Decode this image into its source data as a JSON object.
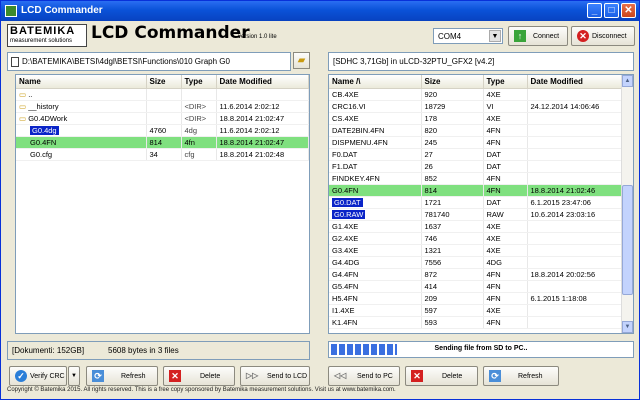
{
  "window": {
    "title": "LCD Commander"
  },
  "header": {
    "brand": "BATEMIKA",
    "brand_sub": "measurement solutions",
    "app_title": "LCD Commander",
    "version": "version 1.0 lite",
    "port": "COM4",
    "connect_label": "Connect",
    "disconnect_label": "Disconnect"
  },
  "left": {
    "path": "D:\\BATEMIKA\\BETSI\\4dgl\\BETSI\\Functions\\010 Graph G0",
    "columns": [
      "Name",
      "Size",
      "Type",
      "Date Modified"
    ],
    "rows": [
      {
        "name": "..",
        "size": "",
        "type": "",
        "date": ""
      },
      {
        "name": "__history",
        "size": "",
        "type": "<DIR>",
        "date": "11.6.2014 2:02:12"
      },
      {
        "name": "G0.4DWork",
        "size": "",
        "type": "<DIR>",
        "date": "18.8.2014 21:02:47"
      },
      {
        "name": "G0.4dg",
        "size": "4760",
        "type": "4dg",
        "date": "11.6.2014 2:02:12"
      },
      {
        "name": "G0.4FN",
        "size": "814",
        "type": "4fn",
        "date": "18.8.2014 21:02:47"
      },
      {
        "name": "G0.cfg",
        "size": "34",
        "type": "cfg",
        "date": "18.8.2014 21:02:48"
      }
    ],
    "status_label": "[Dokumenti: 152GB]",
    "status_info": "5608 bytes in 3 files"
  },
  "right": {
    "path": "[SDHC 3,71Gb] in uLCD-32PTU_GFX2 [v4.2]",
    "columns": [
      "Name  /\\",
      "Size",
      "Type",
      "Date Modified"
    ],
    "rows": [
      {
        "name": "CB.4XE",
        "size": "920",
        "type": "4XE",
        "date": ""
      },
      {
        "name": "CRC16.VI",
        "size": "18729",
        "type": "VI",
        "date": "24.12.2014 14:06:46"
      },
      {
        "name": "CS.4XE",
        "size": "178",
        "type": "4XE",
        "date": ""
      },
      {
        "name": "DATE2BIN.4FN",
        "size": "820",
        "type": "4FN",
        "date": ""
      },
      {
        "name": "DISPMENU.4FN",
        "size": "245",
        "type": "4FN",
        "date": ""
      },
      {
        "name": "F0.DAT",
        "size": "27",
        "type": "DAT",
        "date": ""
      },
      {
        "name": "F1.DAT",
        "size": "26",
        "type": "DAT",
        "date": ""
      },
      {
        "name": "FINDKEY.4FN",
        "size": "852",
        "type": "4FN",
        "date": ""
      },
      {
        "name": "G0.4FN",
        "size": "814",
        "type": "4FN",
        "date": "18.8.2014 21:02:46"
      },
      {
        "name": "G0.DAT",
        "size": "1721",
        "type": "DAT",
        "date": "6.1.2015 23:47:06"
      },
      {
        "name": "G0.RAW",
        "size": "781740",
        "type": "RAW",
        "date": "10.6.2014 23:03:16"
      },
      {
        "name": "G1.4XE",
        "size": "1637",
        "type": "4XE",
        "date": ""
      },
      {
        "name": "G2.4XE",
        "size": "746",
        "type": "4XE",
        "date": ""
      },
      {
        "name": "G3.4XE",
        "size": "1321",
        "type": "4XE",
        "date": ""
      },
      {
        "name": "G4.4DG",
        "size": "7556",
        "type": "4DG",
        "date": ""
      },
      {
        "name": "G4.4FN",
        "size": "872",
        "type": "4FN",
        "date": "18.8.2014 20:02:56"
      },
      {
        "name": "G5.4FN",
        "size": "414",
        "type": "4FN",
        "date": ""
      },
      {
        "name": "H5.4FN",
        "size": "209",
        "type": "4FN",
        "date": "6.1.2015 1:18:08"
      },
      {
        "name": "I1.4XE",
        "size": "597",
        "type": "4XE",
        "date": ""
      },
      {
        "name": "K1.4FN",
        "size": "593",
        "type": "4FN",
        "date": ""
      }
    ],
    "progress_text": "Sending file from SD to PC..",
    "progress_fraction": 0.22
  },
  "toolbar": {
    "verify_crc": "Verify CRC",
    "refresh_left": "Refresh",
    "delete_left": "Delete",
    "send_to_lcd": "Send to LCD",
    "send_to_pc": "Send to PC",
    "delete_right": "Delete",
    "refresh_right": "Refresh"
  },
  "footer": {
    "text": "Copyright © Batemika 2015. All rights reserved. This is a free copy sponsored by Batemika measurement solutions. Visit us at www.batemika.com."
  },
  "colors": {
    "selected_row": "#7fe07f",
    "highlight": "#0a24c8",
    "titlebar": "#0a52d8"
  }
}
